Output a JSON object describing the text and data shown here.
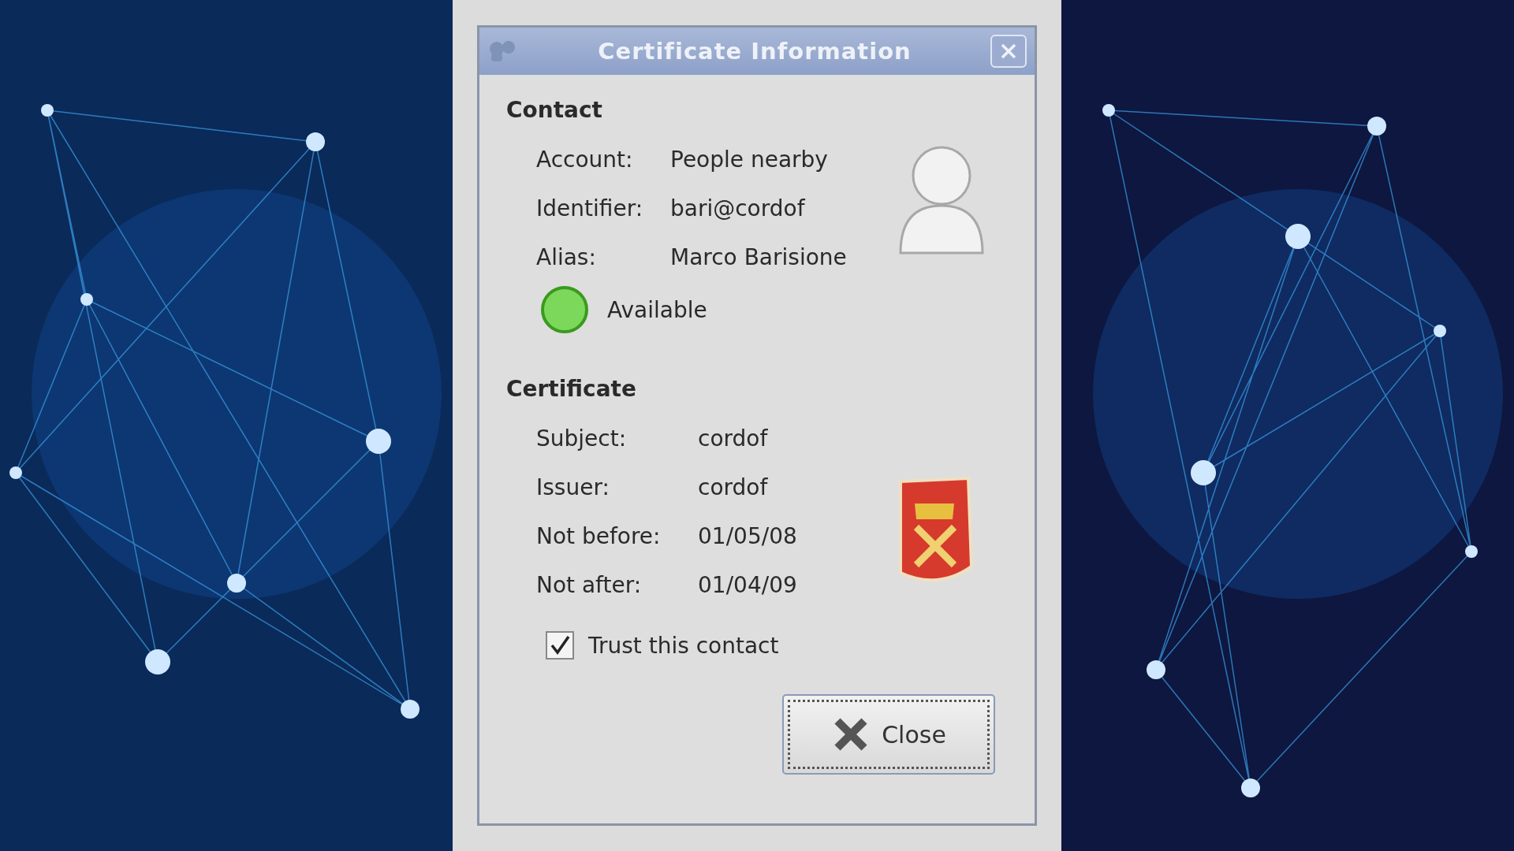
{
  "window": {
    "title": "Certificate Information"
  },
  "contact": {
    "heading": "Contact",
    "fields": [
      {
        "label": "Account:",
        "value": "People nearby"
      },
      {
        "label": "Identifier:",
        "value": "bari@cordof"
      },
      {
        "label": "Alias:",
        "value": "Marco Barisione"
      }
    ],
    "status": {
      "text": "Available",
      "online": true
    }
  },
  "certificate": {
    "heading": "Certificate",
    "fields": [
      {
        "label": "Subject:",
        "value": "cordof"
      },
      {
        "label": "Issuer:",
        "value": "cordof"
      },
      {
        "label": "Not before:",
        "value": "01/05/08"
      },
      {
        "label": "Not after:",
        "value": "01/04/09"
      }
    ]
  },
  "trust": {
    "label": "Trust this contact",
    "checked": true
  },
  "buttons": [
    {
      "label": "Close",
      "kind": "close"
    }
  ]
}
